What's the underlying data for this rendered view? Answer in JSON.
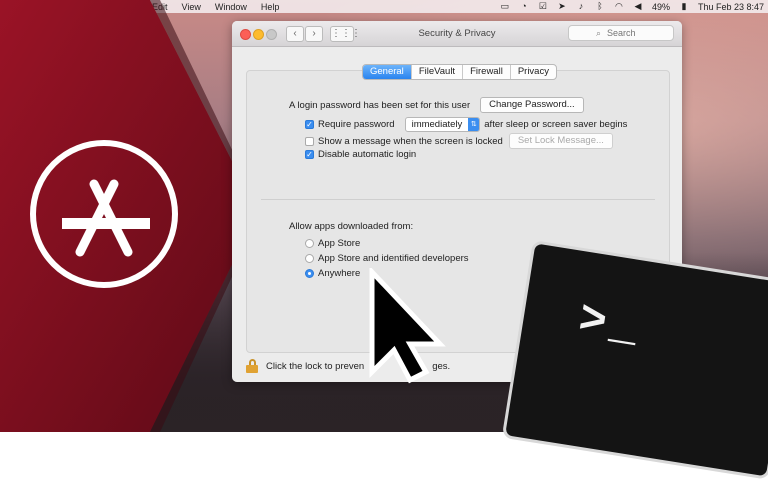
{
  "menubar": {
    "items": [
      "Edit",
      "View",
      "Window",
      "Help"
    ],
    "battery": "49%",
    "clock": "Thu Feb 23  8:47",
    "icons": [
      "screen-record-icon",
      "message-icon",
      "checkbox-icon",
      "location-icon",
      "audio-icon",
      "bluetooth-icon",
      "wifi-icon",
      "volume-icon",
      "battery-icon"
    ]
  },
  "window": {
    "title": "Security & Privacy",
    "search_placeholder": "Search",
    "tabs": [
      {
        "label": "General",
        "active": true
      },
      {
        "label": "FileVault",
        "active": false
      },
      {
        "label": "Firewall",
        "active": false
      },
      {
        "label": "Privacy",
        "active": false
      }
    ],
    "login_text": "A login password has been set for this user",
    "change_password_label": "Change Password...",
    "require_password_label": "Require password",
    "require_password_select": "immediately",
    "after_sleep_text": "after sleep or screen saver begins",
    "show_message_label": "Show a message when the screen is locked",
    "set_lock_message_label": "Set Lock Message...",
    "disable_login_label": "Disable automatic login",
    "allow_apps_title": "Allow apps downloaded from:",
    "options": [
      "App Store",
      "App Store and identified developers",
      "Anywhere"
    ],
    "selected_option": "Anywhere",
    "lock_text": "Click the lock to preven",
    "lock_text_tail": "ges."
  },
  "terminal": {
    "prompt": ">_"
  },
  "colors": {
    "banner": "#7a1020",
    "accent": "#3b8ef0",
    "lock": "#e0a233"
  }
}
